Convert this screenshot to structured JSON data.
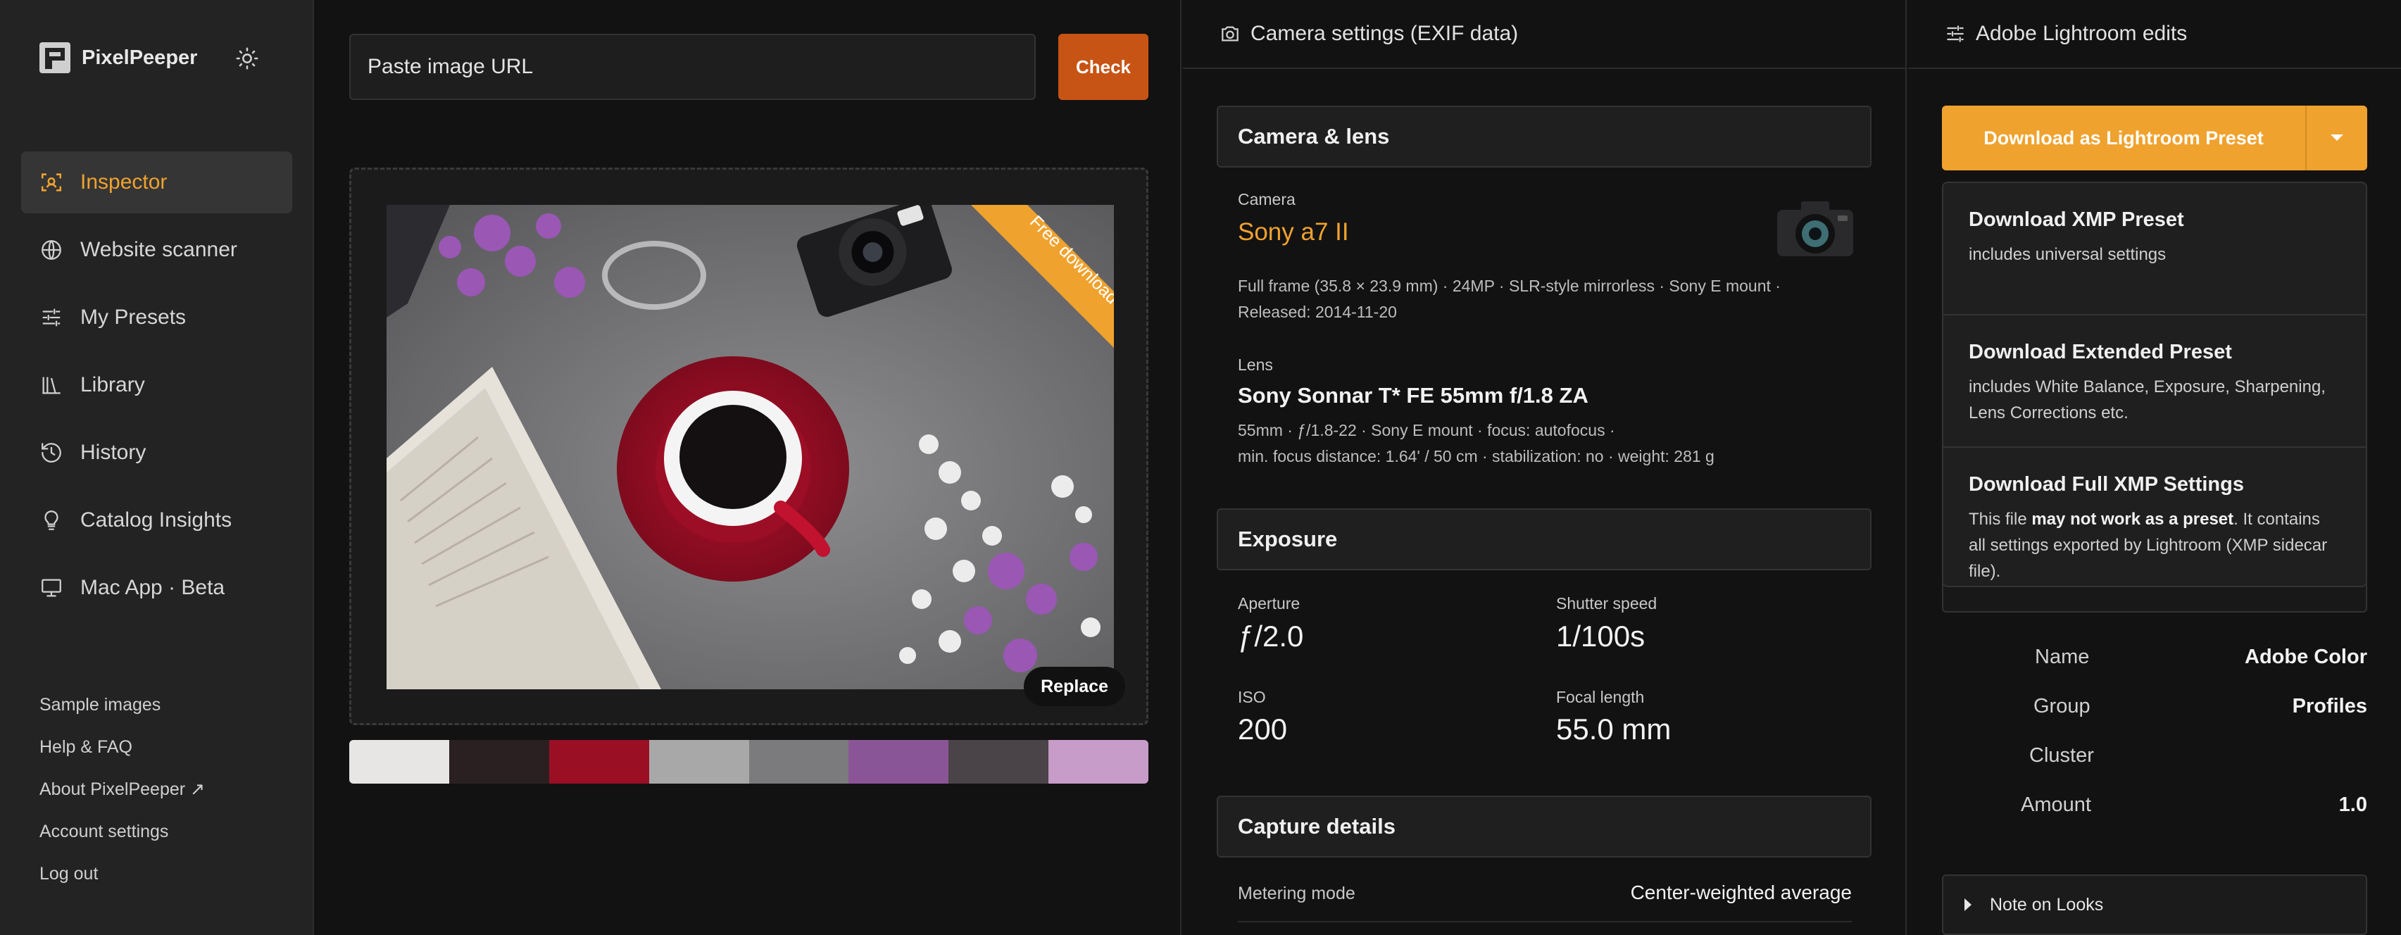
{
  "app": {
    "name": "PixelPeeper"
  },
  "sidebar": {
    "items": [
      {
        "label": "Inspector",
        "icon": "scan-icon",
        "active": true
      },
      {
        "label": "Website scanner",
        "icon": "globe-icon"
      },
      {
        "label": "My Presets",
        "icon": "sliders-icon"
      },
      {
        "label": "Library",
        "icon": "library-icon"
      },
      {
        "label": "History",
        "icon": "history-icon"
      },
      {
        "label": "Catalog Insights",
        "icon": "lightbulb-icon"
      },
      {
        "label": "Mac App · Beta",
        "icon": "monitor-icon"
      }
    ],
    "footer": [
      "Sample images",
      "Help & FAQ",
      "About PixelPeeper ↗",
      "Account settings",
      "Log out"
    ]
  },
  "input": {
    "placeholder": "Paste image URL",
    "check_label": "Check"
  },
  "image": {
    "ribbon": "Free download",
    "replace_label": "Replace"
  },
  "palette": [
    "#e8e6e4",
    "#2a2022",
    "#9a0f24",
    "#a8a8a8",
    "#7b7b7d",
    "#8a5596",
    "#4a4448",
    "#c89cc8"
  ],
  "camera_panel": {
    "title": "Camera settings (EXIF data)",
    "camera_lens": {
      "heading": "Camera & lens",
      "camera_label": "Camera",
      "camera_name": "Sony a7 II",
      "camera_meta_1": "Full frame (35.8 × 23.9 mm)  ·  24MP  ·  SLR-style mirrorless  ·  Sony E mount  ·",
      "camera_meta_2": "Released: 2014-11-20",
      "lens_label": "Lens",
      "lens_name": "Sony Sonnar T* FE 55mm f/1.8 ZA",
      "lens_meta_1": "55mm  ·  ƒ/1.8-22  ·  Sony E mount  ·  focus: autofocus  ·",
      "lens_meta_2": "min. focus distance: 1.64' / 50 cm  ·  stabilization: no  ·  weight: 281 g"
    },
    "exposure": {
      "heading": "Exposure",
      "aperture_label": "Aperture",
      "aperture": "ƒ/2.0",
      "shutter_label": "Shutter speed",
      "shutter": "1/100s",
      "iso_label": "ISO",
      "iso": "200",
      "focal_label": "Focal length",
      "focal": "55.0 mm"
    },
    "capture": {
      "heading": "Capture details",
      "metering_label": "Metering mode",
      "metering": "Center-weighted average"
    }
  },
  "lightroom": {
    "title": "Adobe Lightroom edits",
    "download_label": "Download as Lightroom Preset",
    "menu": [
      {
        "title": "Download XMP Preset",
        "desc_plain": "includes universal settings"
      },
      {
        "title": "Download Extended Preset",
        "desc_plain": "includes White Balance, Exposure, Sharpening, Lens Corrections etc."
      },
      {
        "title": "Download Full XMP Settings",
        "desc_pre": "This file ",
        "desc_bold": "may not work as a preset",
        "desc_post": ". It contains all settings exported by Lightroom (XMP sidecar file)."
      }
    ],
    "profile": {
      "name_label": "Name",
      "name": "Adobe Color",
      "group_label": "Group",
      "group": "Profiles",
      "cluster_label": "Cluster",
      "amount_label": "Amount",
      "amount": "1.0"
    },
    "note_label": "Note on Looks"
  }
}
